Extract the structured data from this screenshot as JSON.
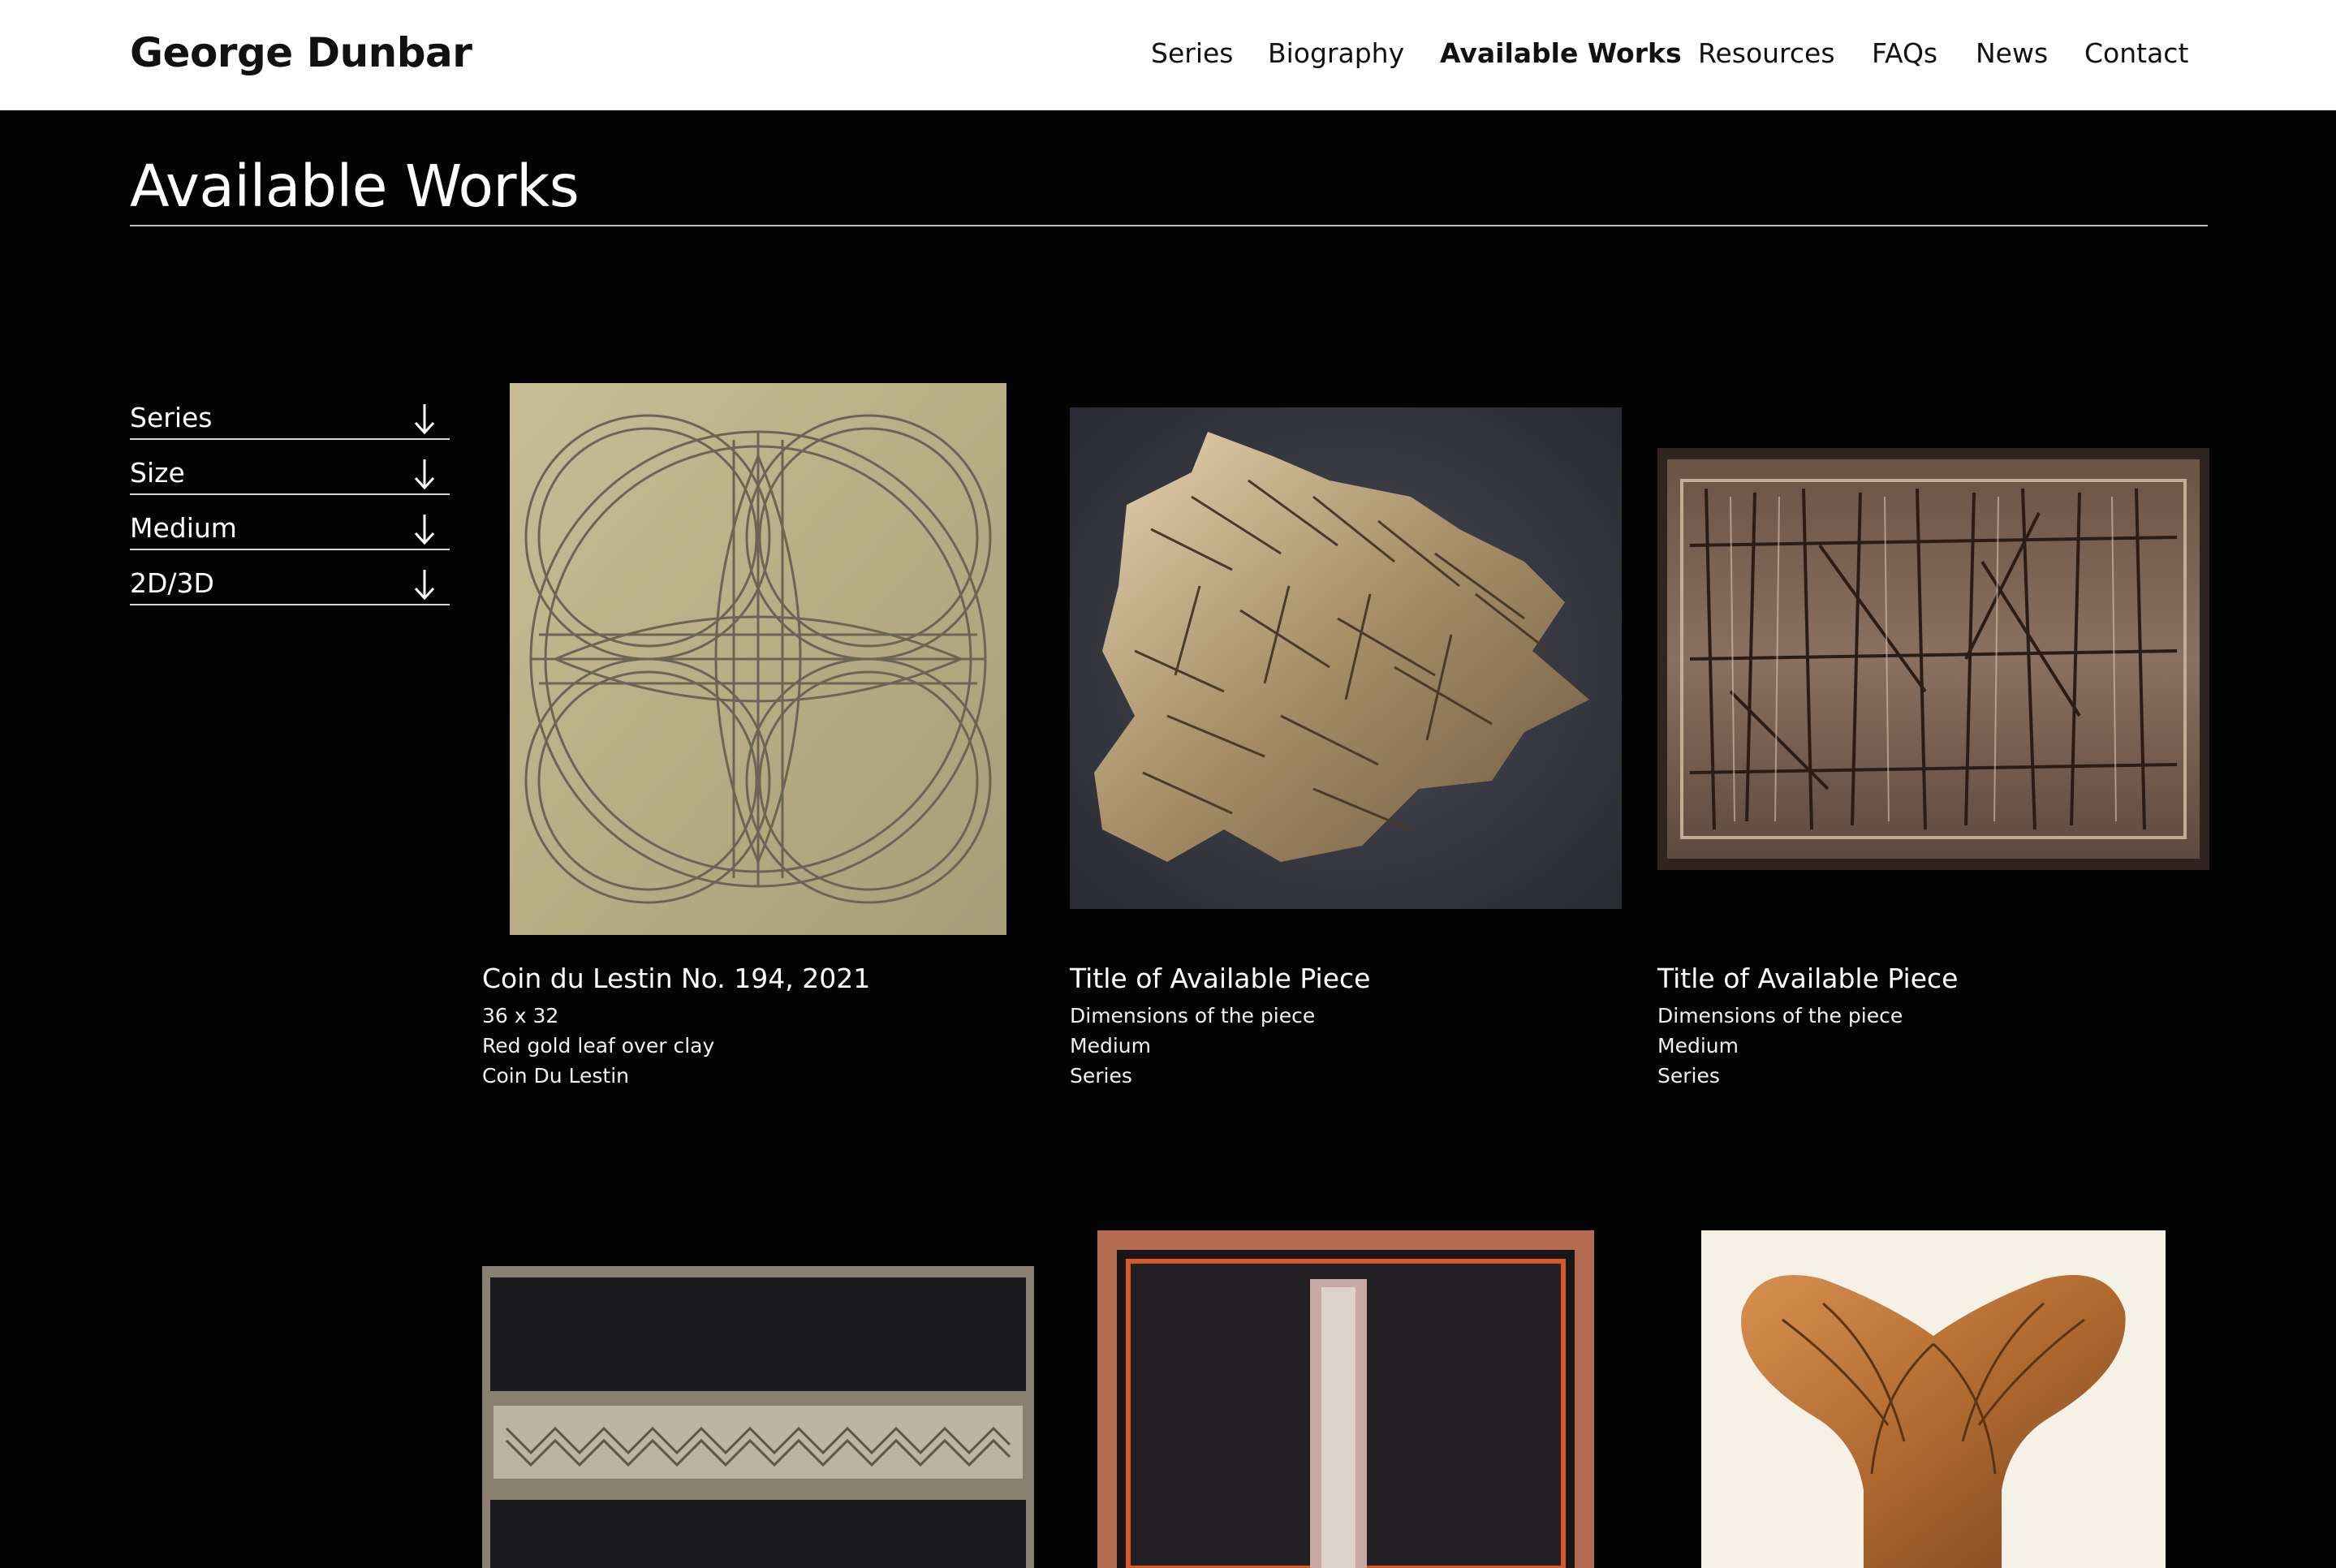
{
  "header": {
    "brand": "George Dunbar",
    "nav": [
      "Series",
      "Biography",
      "Available Works",
      "Resources",
      "FAQs",
      "News",
      "Contact"
    ],
    "active": "Available Works"
  },
  "page": {
    "title": "Available Works"
  },
  "filters": [
    "Series",
    "Size",
    "Medium",
    "2D/3D"
  ],
  "works": [
    {
      "title": "Coin du Lestin No. 194, 2021",
      "dimensions": "36 x 32",
      "medium": "Red gold leaf over clay",
      "series": "Coin Du Lestin"
    },
    {
      "title": "Title of Available Piece",
      "dimensions": "Dimensions of the piece",
      "medium": "Medium",
      "series": "Series"
    },
    {
      "title": "Title of Available Piece",
      "dimensions": "Dimensions of the piece",
      "medium": "Medium",
      "series": "Series"
    }
  ],
  "colors": {
    "background": "#030303",
    "header": "#ffffff",
    "text": "#ffffff",
    "rule": "#bdbdbd"
  }
}
